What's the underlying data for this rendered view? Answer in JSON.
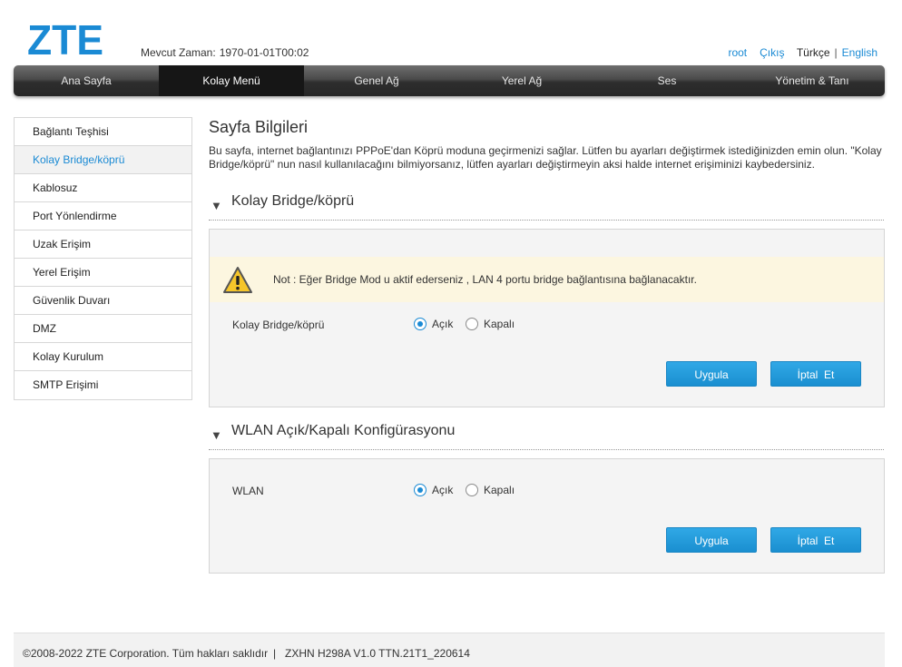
{
  "header": {
    "logo_text": "ZTE",
    "time_label": "Mevcut Zaman:",
    "time_value": "1970-01-01T00:02",
    "user": "root",
    "logout": "Çıkış",
    "lang_current": "Türkçe",
    "lang_sep": "|",
    "lang_other": "English"
  },
  "nav": [
    "Ana Sayfa",
    "Kolay Menü",
    "Genel Ağ",
    "Yerel Ağ",
    "Ses",
    "Yönetim & Tanı"
  ],
  "sidebar": [
    "Bağlantı Teşhisi",
    "Kolay Bridge/köprü",
    "Kablosuz",
    "Port Yönlendirme",
    "Uzak Erişim",
    "Yerel Erişim",
    "Güvenlik Duvarı",
    "DMZ",
    "Kolay Kurulum",
    "SMTP Erişimi"
  ],
  "page": {
    "title": "Sayfa Bilgileri",
    "description": "Bu sayfa, internet bağlantınızı PPPoE'dan Köprü moduna geçirmenizi sağlar. Lütfen bu ayarları değiştirmek istediğinizden emin olun. \"Kolay Bridge/köprü\" nun nasıl kullanılacağını bilmiyorsanız, lütfen ayarları değiştirmeyin aksi halde internet erişiminizi kaybedersiniz."
  },
  "bridge": {
    "heading": "Kolay Bridge/köprü",
    "note": "Not : Eğer Bridge Mod u aktif ederseniz , LAN 4 portu bridge bağlantısına bağlanacaktır.",
    "label": "Kolay Bridge/köprü",
    "opt_on": "Açık",
    "opt_off": "Kapalı",
    "apply": "Uygula",
    "cancel": "İptal  Et"
  },
  "wlan": {
    "heading": "WLAN Açık/Kapalı Konfigürasyonu",
    "label": "WLAN",
    "opt_on": "Açık",
    "opt_off": "Kapalı",
    "apply": "Uygula",
    "cancel": "İptal  Et"
  },
  "footer": {
    "copyright": "©2008-2022 ZTE Corporation. Tüm hakları saklıdır",
    "sep": "|",
    "version": "ZXHN H298A V1.0 TTN.21T1_220614"
  },
  "colors": {
    "accent": "#1a8ad4",
    "nav_bg": "#2e2e2e",
    "note_bg": "#fcf6e0"
  },
  "state": {
    "active_nav": "Kolay Menü",
    "active_sidebar": "Kolay Bridge/köprü",
    "bridge_selected": "Açık",
    "wlan_selected": "Açık"
  }
}
